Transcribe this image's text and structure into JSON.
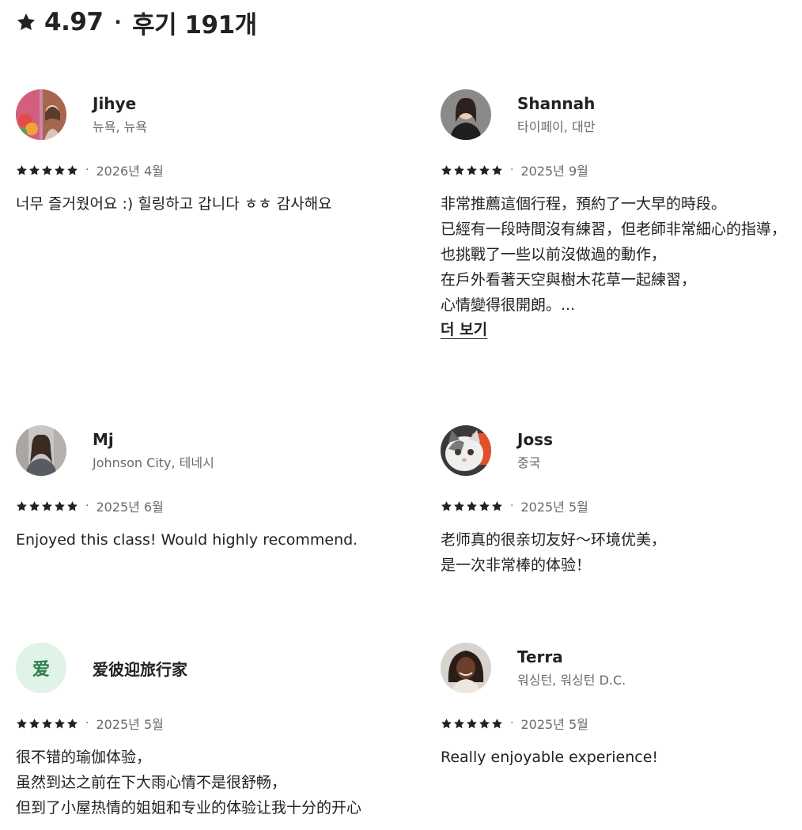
{
  "header": {
    "rating": "4.97",
    "separator": "·",
    "review_count": "후기 191개"
  },
  "reviews": [
    {
      "name": "Jihye",
      "location": "뉴욕, 뉴욕",
      "stars": 5,
      "date": "2026년 4월",
      "text": "너무 즐거웠어요 :) 힐링하고 갑니다 ㅎㅎ 감사해요"
    },
    {
      "name": "Shannah",
      "location": "타이페이, 대만",
      "stars": 5,
      "date": "2025년 9월",
      "text": "非常推薦這個行程，預約了一大早的時段。\n已經有一段時間沒有練習，但老師非常細心的指導，\n也挑戰了一些以前沒做過的動作，\n在戶外看著天空與樹木花草一起練習，\n心情變得很開朗。...",
      "more_label": "더 보기"
    },
    {
      "name": "Mj",
      "location": "Johnson City, 테네시",
      "stars": 5,
      "date": "2025년 6월",
      "text": "Enjoyed this class! Would highly recommend."
    },
    {
      "name": "Joss",
      "location": "중국",
      "stars": 5,
      "date": "2025년 5월",
      "text": "老师真的很亲切友好～环境优美，\n是一次非常棒的体验！"
    },
    {
      "name": "爱彼迎旅行家",
      "avatar_letter": "爱",
      "stars": 5,
      "date": "2025년 5월",
      "text": "很不错的瑜伽体验，\n虽然到达之前在下大雨心情不是很舒畅，\n但到了小屋热情的姐姐和专业的体验让我十分的开心"
    },
    {
      "name": "Terra",
      "location": "워싱턴, 워싱턴 D.C.",
      "stars": 5,
      "date": "2025년 5월",
      "text": "Really enjoyable experience!"
    }
  ],
  "meta_separator": "·",
  "colors": {
    "text": "#222222",
    "muted": "#6a6a6a",
    "letter_avatar_bg": "#dff3e6",
    "letter_avatar_fg": "#2e7d4f"
  }
}
